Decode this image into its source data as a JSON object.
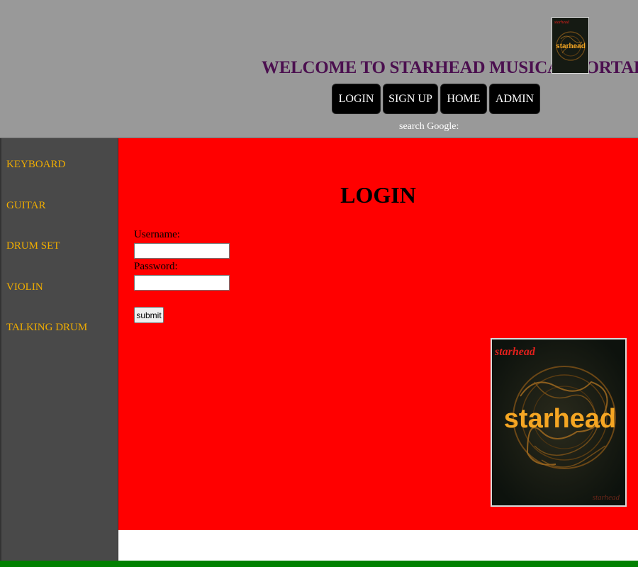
{
  "header": {
    "welcome": "WELCOME TO STARHEAD MUSICAL PORTAL",
    "logo_text": "starhead",
    "nav": [
      {
        "label": "LOGIN"
      },
      {
        "label": "SIGN UP"
      },
      {
        "label": "HOME"
      },
      {
        "label": "ADMIN"
      }
    ],
    "search_label": "search Google:"
  },
  "sidebar": {
    "items": [
      {
        "label": "KEYBOARD"
      },
      {
        "label": "GUITAR"
      },
      {
        "label": "DRUM SET"
      },
      {
        "label": "VIOLIN"
      },
      {
        "label": "TALKING DRUM"
      }
    ]
  },
  "login": {
    "title": "LOGIN",
    "username_label": "Username:",
    "username_value": "",
    "password_label": "Password:",
    "password_value": "",
    "submit_label": "submit"
  },
  "logo": {
    "text": "starhead",
    "corner_text": "starhead",
    "signature": "starhead"
  },
  "colors": {
    "header_bg": "#999999",
    "welcome_text": "#4b0f4f",
    "sidebar_bg": "#494949",
    "sidebar_link": "#f0ad00",
    "main_bg": "#ff0000",
    "footer_bar": "#008000",
    "nav_button_bg": "#000000",
    "logo_accent": "#f5a623"
  }
}
